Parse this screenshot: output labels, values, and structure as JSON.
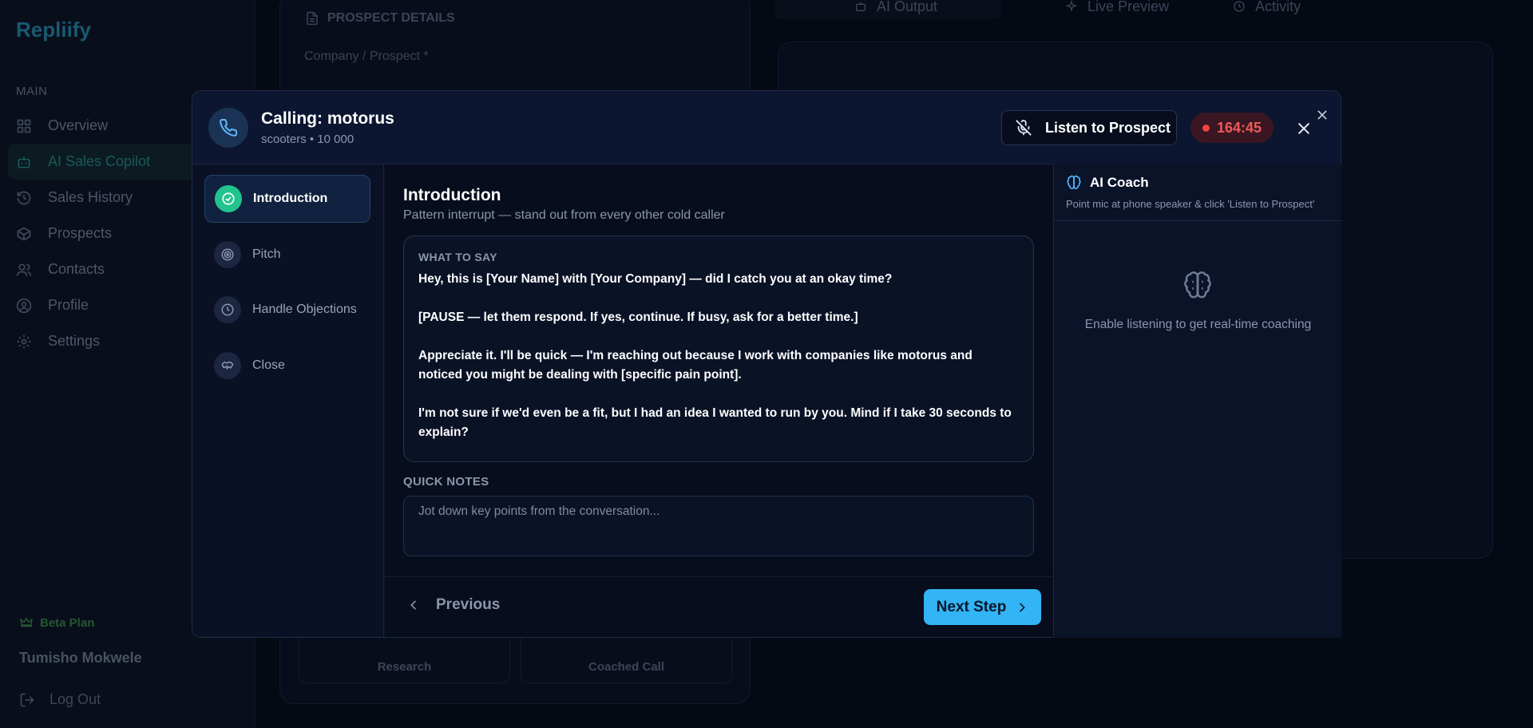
{
  "app": {
    "logo": "Repliify",
    "nav_section": "MAIN",
    "nav_items": [
      {
        "label": "Overview",
        "icon": "grid-icon"
      },
      {
        "label": "AI Sales Copilot",
        "icon": "bot-icon"
      },
      {
        "label": "Sales History",
        "icon": "history-icon"
      },
      {
        "label": "Prospects",
        "icon": "box-icon"
      },
      {
        "label": "Contacts",
        "icon": "users-icon"
      },
      {
        "label": "Profile",
        "icon": "user-circle-icon"
      },
      {
        "label": "Settings",
        "icon": "gear-icon"
      }
    ],
    "plan": "Beta Plan",
    "user_name": "Tumisho Mokwele",
    "logout": "Log Out",
    "card_title": "PROSPECT DETAILS",
    "company_label": "Company / Prospect *",
    "bottom_buttons": [
      "Research",
      "Coached Call"
    ],
    "tabs": [
      "AI Output",
      "Live Preview",
      "Activity"
    ]
  },
  "modal": {
    "title": "Calling: motorus",
    "subtitle": "scooters • 10 000",
    "listen_label": "Listen to Prospect",
    "timer": "164:45",
    "steps": [
      {
        "label": "Introduction",
        "icon": "check-circle-icon",
        "active": true
      },
      {
        "label": "Pitch",
        "icon": "target-icon",
        "active": false
      },
      {
        "label": "Handle Objections",
        "icon": "clock-icon",
        "active": false
      },
      {
        "label": "Close",
        "icon": "handshake-icon",
        "active": false
      }
    ],
    "section": {
      "title": "Introduction",
      "subtitle": "Pattern interrupt — stand out from every other cold caller"
    },
    "what_to_say": {
      "label": "WHAT TO SAY",
      "paragraphs": [
        "Hey, this is [Your Name] with [Your Company] — did I catch you at an okay time?",
        "[PAUSE — let them respond. If yes, continue. If busy, ask for a better time.]",
        "Appreciate it. I'll be quick — I'm reaching out because I work with companies like motorus and noticed you might be dealing with [specific pain point].",
        "I'm not sure if we'd even be a fit, but I had an idea I wanted to run by you. Mind if I take 30 seconds to explain?"
      ]
    },
    "notes": {
      "label": "QUICK NOTES",
      "placeholder": "Jot down key points from the conversation...",
      "value": ""
    },
    "previous_label": "Previous",
    "next_label": "Next Step",
    "coach": {
      "title": "AI Coach",
      "subtitle": "Point mic at phone speaker & click 'Listen to Prospect'",
      "empty_text": "Enable listening to get real-time coaching"
    },
    "colors": {
      "accent": "#33b4f4",
      "success": "#22c38e",
      "danger": "#ef4444"
    }
  }
}
